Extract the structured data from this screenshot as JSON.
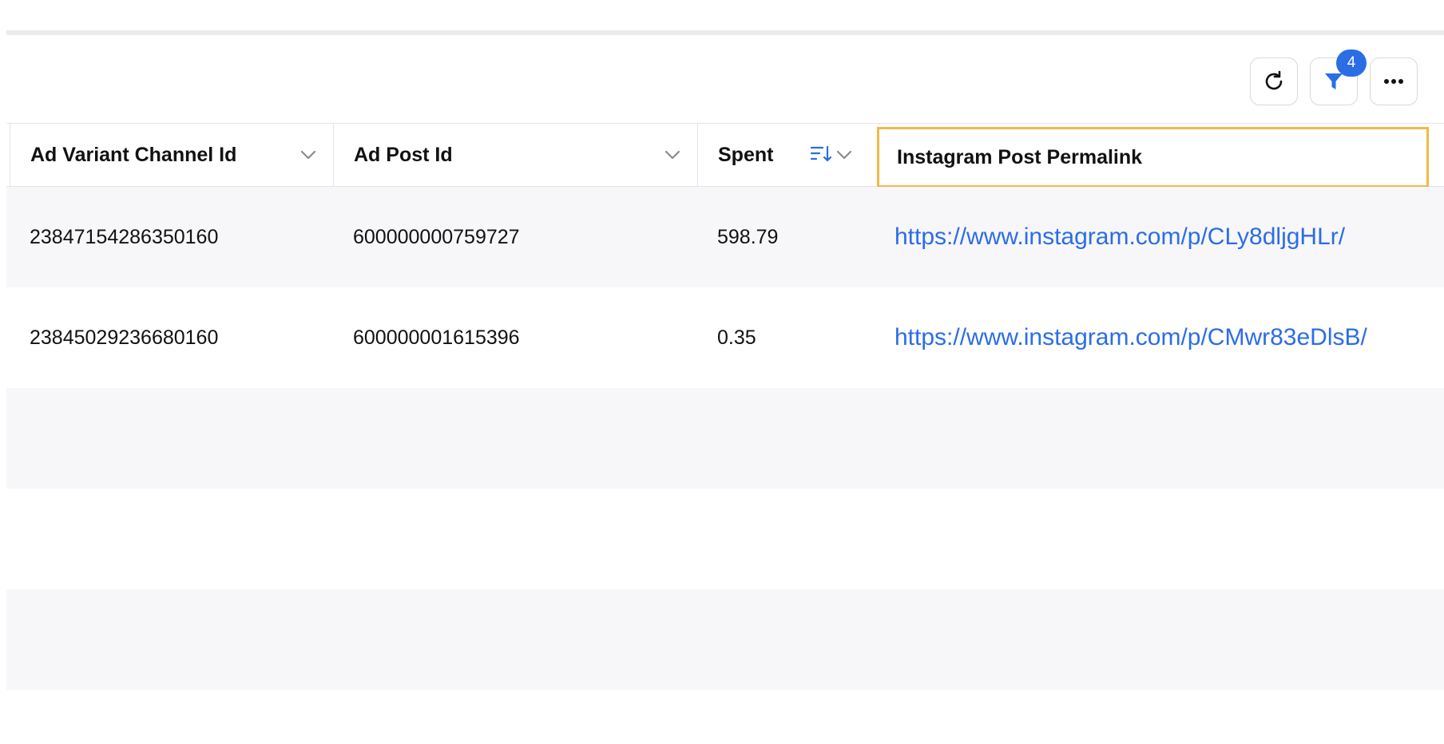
{
  "toolbar": {
    "refresh_icon": "refresh-icon",
    "filter_icon": "filter-icon",
    "filter_count": "4",
    "more_icon": "more-horizontal-icon"
  },
  "table": {
    "columns": [
      {
        "label": "Ad Variant Channel Id"
      },
      {
        "label": "Ad Post Id"
      },
      {
        "label": "Spent"
      },
      {
        "label": "Instagram Post Permalink"
      }
    ],
    "rows": [
      {
        "ad_variant_channel_id": "23847154286350160",
        "ad_post_id": "600000000759727",
        "spent": "598.79",
        "permalink": "https://www.instagram.com/p/CLy8dljgHLr/"
      },
      {
        "ad_variant_channel_id": "23845029236680160",
        "ad_post_id": "600000001615396",
        "spent": "0.35",
        "permalink": "https://www.instagram.com/p/CMwr83eDlsB/"
      }
    ]
  },
  "colors": {
    "accent": "#2b6de5",
    "selected_border": "#f3b84a",
    "alt_row": "#f7f7f9"
  }
}
